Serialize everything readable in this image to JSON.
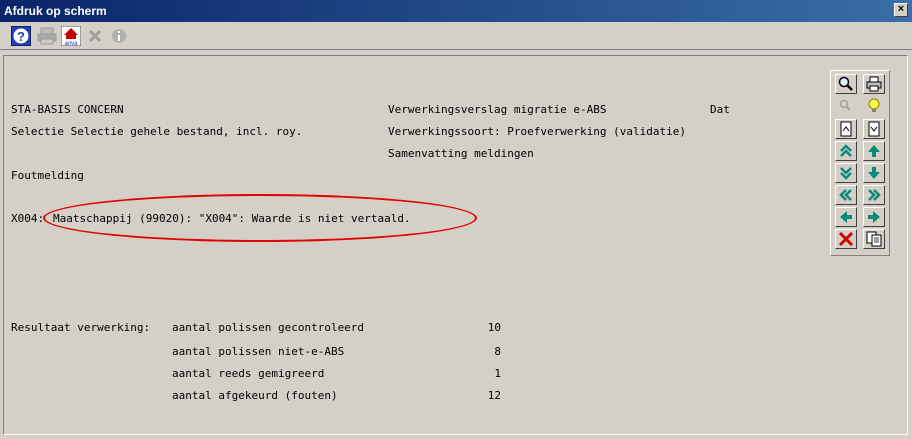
{
  "window": {
    "title": "Afdruk op scherm",
    "close_label": "×"
  },
  "toolbar": {
    "help_icon": "help-icon",
    "print_icon": "print-icon",
    "anva_label": "anva",
    "cancel_icon": "cancel-icon",
    "info_icon": "info-icon"
  },
  "report": {
    "line1_left": "STA-BASIS CONCERN",
    "line1_mid": "Verwerkingsverslag migratie e-ABS",
    "line1_right": "Dat",
    "line2_left": "Selectie Selectie gehele bestand, incl. roy.",
    "line2_mid": "Verwerkingssoort: Proefverwerking (validatie)",
    "line3_mid": "Samenvatting meldingen",
    "section": "Foutmelding",
    "error_code": "X004:",
    "error_text": "Maatschappij (99020): \"X004\": Waarde is niet vertaald.",
    "result_label": "Resultaat verwerking:",
    "results": [
      {
        "label": "aantal polissen gecontroleerd",
        "value": "10"
      },
      {
        "label": "aantal polissen niet-e-ABS",
        "value": "8"
      },
      {
        "label": "aantal reeds gemigreerd",
        "value": "1"
      },
      {
        "label": "aantal afgekeurd (fouten)",
        "value": "12"
      }
    ]
  },
  "colors": {
    "titlebar": "#0a246a",
    "highlight": "#e00000",
    "nav_teal": "#0a8a7a"
  }
}
